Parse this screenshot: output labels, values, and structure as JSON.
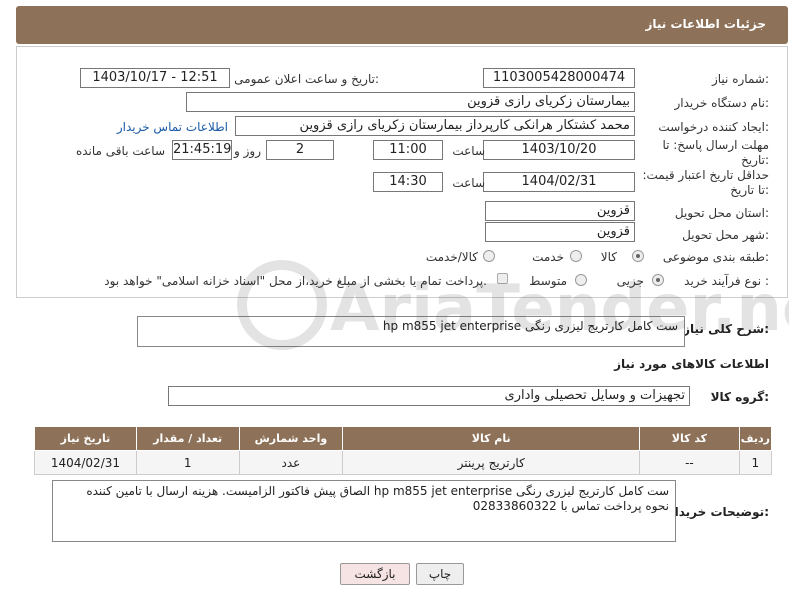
{
  "header": {
    "title": "جزئیات اطلاعات نیاز"
  },
  "fields": {
    "need_number_label": "شماره نیاز:",
    "need_number": "1103005428000474",
    "announce_label": "تاریخ و ساعت اعلان عمومی:",
    "announce_value": "1403/10/17 - 12:51",
    "buyer_org_label": "نام دستگاه خریدار:",
    "buyer_org": "بیمارستان زکریای رازی قزوین",
    "creator_label": "ایجاد کننده درخواست:",
    "creator": "محمد کشتکار هرانکی کارپرداز بیمارستان زکریای رازی قزوین",
    "contact_link": "اطلاعات تماس خریدار",
    "deadline_label": "مهلت ارسال پاسخ: تا تاریخ:",
    "deadline_date": "1403/10/20",
    "time_label": "ساعت",
    "deadline_time": "11:00",
    "days_value": "2",
    "days_label": "روز و",
    "remaining_value": "21:45:19",
    "remaining_label": "ساعت باقی مانده",
    "price_valid_label": "حداقل تاریخ اعتبار قیمت: تا تاریخ:",
    "price_valid_date": "1404/02/31",
    "price_valid_time": "14:30",
    "province_label": "استان محل تحویل:",
    "province": "قزوین",
    "city_label": "شهر محل تحویل:",
    "city": "قزوین",
    "category_label": "طبقه بندی موضوعی:",
    "cat_goods": "کالا",
    "cat_service": "خدمت",
    "cat_goods_service": "کالا/خدمت",
    "process_label": "نوع فرآیند خرید :",
    "proc_partial": "جزیی",
    "proc_medium": "متوسط",
    "proc_note": "پرداخت تمام یا بخشی از مبلغ خرید،از محل \"اسناد خزانه اسلامی\" خواهد بود."
  },
  "summary": {
    "label": "شرح کلی نیاز:",
    "text": "ست کامل کارتریج لیزری رنگی hp m855 jet enterprise"
  },
  "goods_info_title": "اطلاعات کالاهای مورد نیاز",
  "goods_group": {
    "label": "گروه کالا:",
    "value": "تجهیزات و وسایل تحصیلی واداری"
  },
  "table": {
    "headers": {
      "row": "ردیف",
      "code": "کد کالا",
      "name": "نام کالا",
      "unit": "واحد شمارش",
      "qty": "تعداد / مقدار",
      "date": "تاریخ نیاز"
    },
    "rows": [
      {
        "row": "1",
        "code": "--",
        "name": "کارتریج پرینتر",
        "unit": "عدد",
        "qty": "1",
        "date": "1404/02/31"
      }
    ]
  },
  "buyer_notes": {
    "label": "توضیحات خریدار:",
    "text": "ست کامل کارتریج لیزری رنگی hp m855 jet enterprise الصاق پیش فاکتور الزامیست. هزینه ارسال با تامین کننده نحوه پرداخت تماس با 02833860322"
  },
  "buttons": {
    "print": "چاپ",
    "back": "بازگشت"
  },
  "watermark_text": "AriaTender.neT"
}
